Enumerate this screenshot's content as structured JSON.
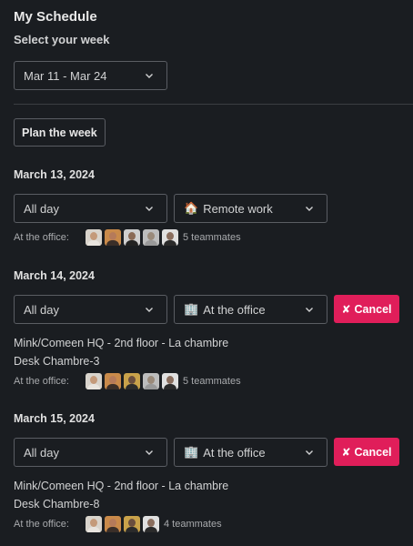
{
  "header": {
    "title": "My Schedule",
    "week_label": "Select your week",
    "week_value": "Mar 11 - Mar 24",
    "plan_button": "Plan the week"
  },
  "office_label": "At the office:",
  "days": [
    {
      "date": "March 13, 2024",
      "time": "All day",
      "location_icon": "house-emoji",
      "location": "Remote work",
      "teammates": "5 teammates"
    },
    {
      "date": "March 14, 2024",
      "time": "All day",
      "location_icon": "office-building-emoji",
      "location": "At the office",
      "cancel": "Cancel",
      "place": "Mink/Comeen HQ - 2nd floor - La chambre",
      "desk": "Desk Chambre-3",
      "teammates": "5 teammates"
    },
    {
      "date": "March 15, 2024",
      "time": "All day",
      "location_icon": "office-building-emoji",
      "location": "At the office",
      "cancel": "Cancel",
      "place": "Mink/Comeen HQ - 2nd floor - La chambre",
      "desk": "Desk Chambre-8",
      "teammates": "4 teammates"
    }
  ],
  "colors": {
    "background": "#1a1d21",
    "cancel": "#e01e5a",
    "border": "#5a5d63"
  }
}
